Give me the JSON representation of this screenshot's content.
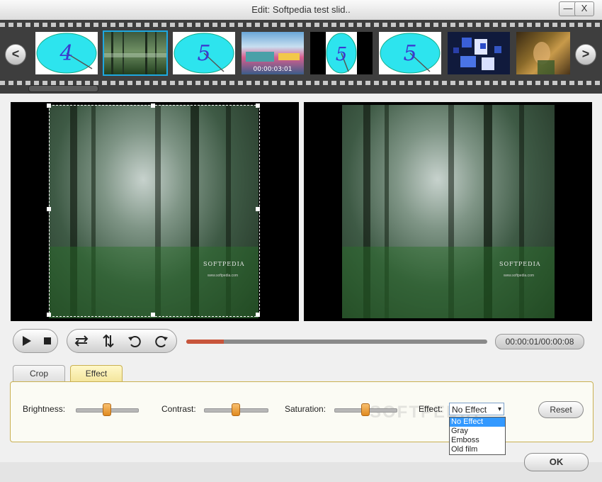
{
  "window": {
    "title": "Edit: Softpedia test slid..",
    "minimize_label": "—",
    "close_label": "X"
  },
  "filmstrip": {
    "prev_label": "<",
    "next_label": ">",
    "thumbs": [
      {
        "kind": "digit",
        "text": "4"
      },
      {
        "kind": "forest",
        "text": ""
      },
      {
        "kind": "digit",
        "text": "5"
      },
      {
        "kind": "video",
        "text": "00:00:03:01"
      },
      {
        "kind": "digit",
        "text": "5"
      },
      {
        "kind": "digit",
        "text": "5"
      },
      {
        "kind": "graphic",
        "text": ""
      },
      {
        "kind": "photo",
        "text": ""
      }
    ]
  },
  "preview": {
    "image_brand": "SOFTPEDIA",
    "image_url": "www.softpedia.com"
  },
  "playback": {
    "play_icon": "play-icon",
    "stop_icon": "stop-icon",
    "flip_h_icon": "flip-horizontal-icon",
    "flip_v_icon": "flip-vertical-icon",
    "rotate_ccw_icon": "rotate-left-icon",
    "rotate_cw_icon": "rotate-right-icon",
    "progress": 0.125,
    "time": "00:00:01/00:00:08"
  },
  "tabs": [
    {
      "label": "Crop",
      "active": false
    },
    {
      "label": "Effect",
      "active": true
    }
  ],
  "effect_panel": {
    "brightness_label": "Brightness:",
    "brightness_value": 0.5,
    "contrast_label": "Contrast:",
    "contrast_value": 0.5,
    "saturation_label": "Saturation:",
    "saturation_value": 0.5,
    "effect_label": "Effect:",
    "effect_selected": "No Effect",
    "effect_options": [
      "No Effect",
      "Gray",
      "Emboss",
      "Old film"
    ],
    "reset_label": "Reset",
    "watermark": "SOFTPEDIA"
  },
  "ok_label": "OK",
  "colors": {
    "accent": "#1ea7e0",
    "progress": "#c8553b",
    "slider_knob": "#e08a20",
    "panel_border": "#c9b052",
    "dropdown_highlight": "#3399ff"
  }
}
